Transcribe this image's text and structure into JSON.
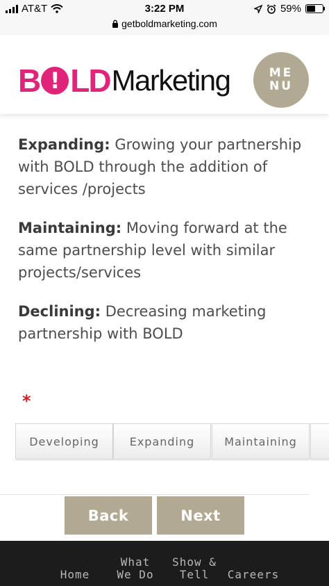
{
  "status_bar": {
    "carrier": "AT&T",
    "time": "3:22 PM",
    "battery": "59%",
    "battery_level": 0.59
  },
  "browser": {
    "url": "getboldmarketing.com"
  },
  "header": {
    "logo_part1": "B",
    "logo_bang": "!",
    "logo_part2": "LD",
    "logo_part3": "Marketing",
    "menu_line1": "ME",
    "menu_line2": "NU"
  },
  "content": {
    "items": [
      {
        "term": "Expanding:",
        "desc": " Growing your partnership with BOLD through the addition of services /projects"
      },
      {
        "term": "Maintaining:",
        "desc": " Moving forward at the same partnership level with similar projects/services"
      },
      {
        "term": "Declining:",
        "desc": " Decreasing marketing partnership with BOLD"
      }
    ],
    "required_mark": "*"
  },
  "choices": [
    "Developing",
    "Expanding",
    "Maintaining",
    ""
  ],
  "buttons": {
    "back": "Back",
    "next": "Next"
  },
  "footer": {
    "items": [
      {
        "line1": "",
        "line2": "Home"
      },
      {
        "line1": "What",
        "line2": "We Do"
      },
      {
        "line1": "Show &",
        "line2": "Tell"
      },
      {
        "line1": "",
        "line2": "Careers"
      }
    ]
  },
  "colors": {
    "brand_pink": "#e0247a",
    "accent_taupe": "#b2a993",
    "footer_bg": "#1c1c1c",
    "required_red": "#cc2222"
  }
}
